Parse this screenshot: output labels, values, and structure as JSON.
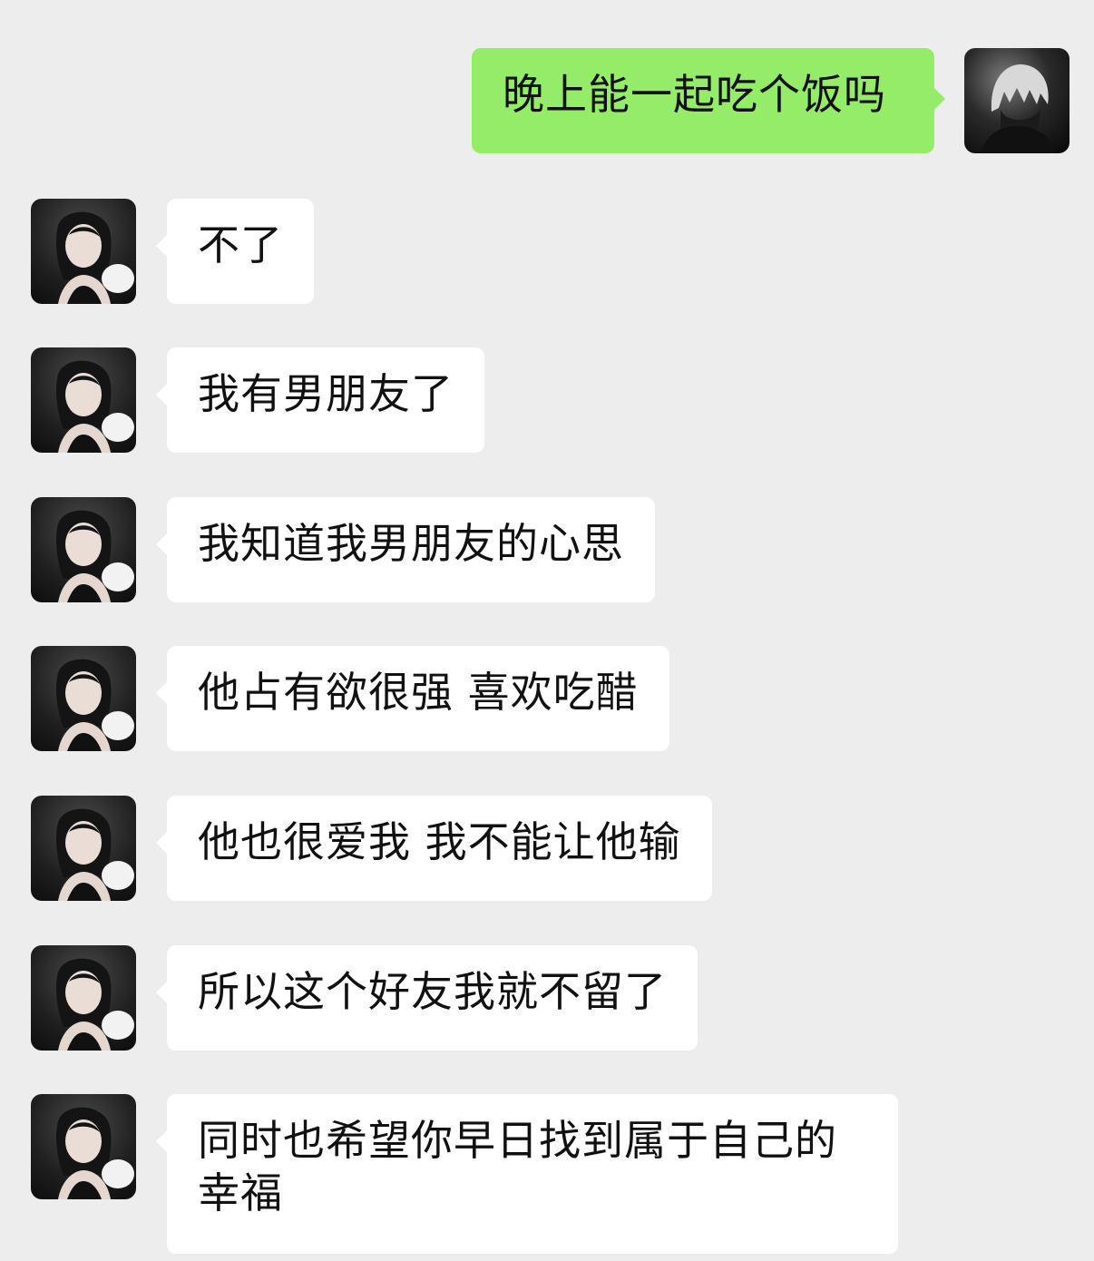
{
  "conversation": {
    "self_message": {
      "text": "晚上能一起吃个饭吗",
      "avatar_icon": "dark-silver-haired-avatar"
    },
    "other_avatar_icon": "woman-portrait-avatar",
    "other_messages": [
      {
        "text": "不了"
      },
      {
        "text": "我有男朋友了"
      },
      {
        "text": "我知道我男朋友的心思"
      },
      {
        "text": "他占有欲很强 喜欢吃醋"
      },
      {
        "text": "他也很爱我 我不能让他输"
      },
      {
        "text": "所以这个好友我就不留了"
      },
      {
        "text": "同时也希望你早日找到属于自己的幸福"
      }
    ],
    "colors": {
      "background": "#ededed",
      "self_bubble": "#95ec69",
      "other_bubble": "#ffffff",
      "text": "#111111"
    }
  }
}
